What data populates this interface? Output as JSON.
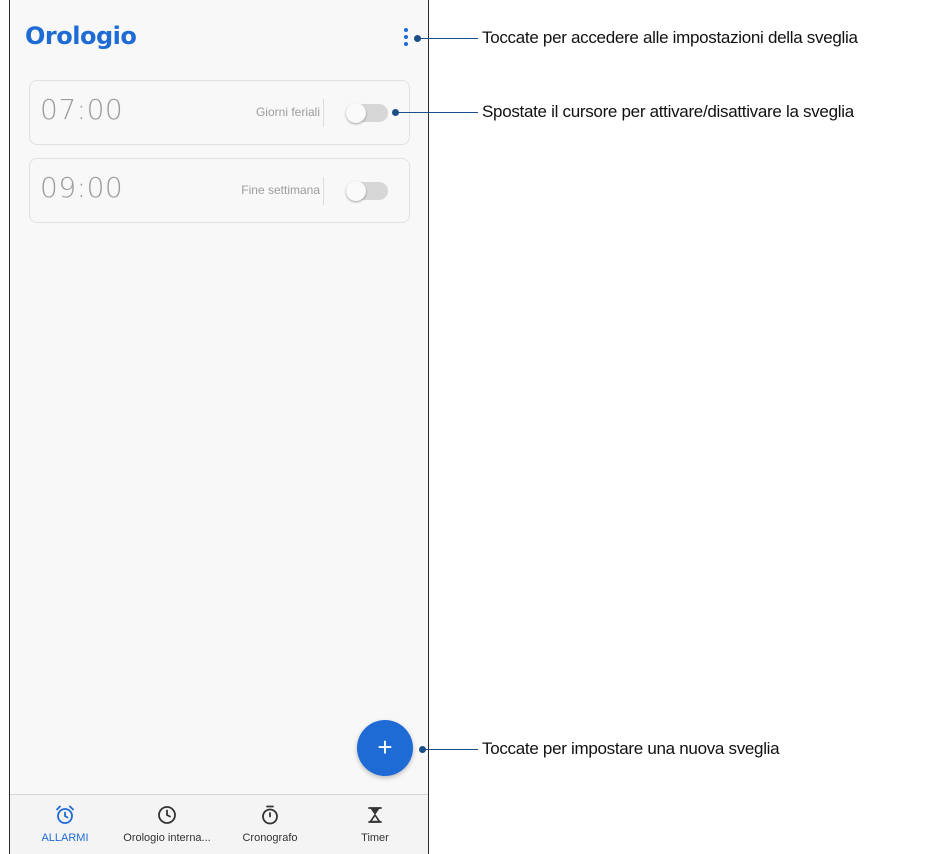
{
  "app": {
    "title": "Orologio"
  },
  "colors": {
    "accent": "#1f6bd6",
    "callout_line": "#1c4e8a",
    "toggle_off": "#d7d7d7"
  },
  "alarms": [
    {
      "time": "07:00",
      "days": "Giorni feriali",
      "enabled": false
    },
    {
      "time": "09:00",
      "days": "Fine settimana",
      "enabled": false
    }
  ],
  "fab": {
    "icon": "add-icon",
    "label": "+"
  },
  "bottom_nav": {
    "tabs": [
      {
        "label": "ALLARMI",
        "icon": "alarm-clock-icon",
        "active": true
      },
      {
        "label": "Orologio interna...",
        "icon": "clock-icon",
        "active": false
      },
      {
        "label": "Cronografo",
        "icon": "stopwatch-icon",
        "active": false
      },
      {
        "label": "Timer",
        "icon": "hourglass-icon",
        "active": false
      }
    ]
  },
  "callouts": [
    {
      "text": "Toccate per accedere alle impostazioni della sveglia"
    },
    {
      "text": "Spostate il cursore per attivare/disattivare la sveglia"
    },
    {
      "text": "Toccate per impostare una nuova sveglia"
    }
  ]
}
